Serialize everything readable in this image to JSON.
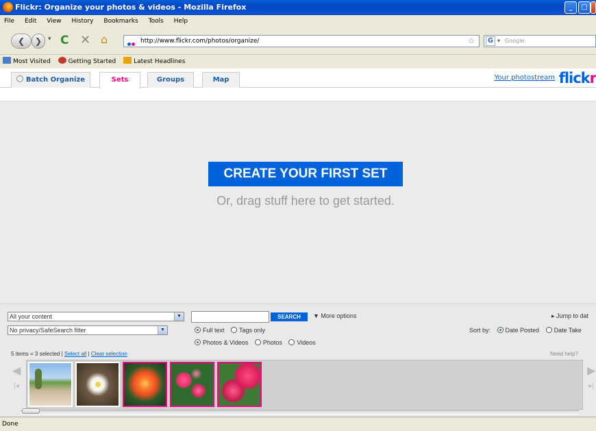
{
  "window": {
    "title": "Flickr: Organize your photos & videos - Mozilla Firefox"
  },
  "menu": [
    "File",
    "Edit",
    "View",
    "History",
    "Bookmarks",
    "Tools",
    "Help"
  ],
  "nav": {
    "url": "http://www.flickr.com/photos/organize/",
    "search_placeholder": "Google"
  },
  "bookmarks": [
    {
      "label": "Most Visited",
      "icon": "most-visited-icon",
      "color": "#4a7fc6"
    },
    {
      "label": "Getting Started",
      "icon": "firefox-icon",
      "color": "#c0392b"
    },
    {
      "label": "Latest Headlines",
      "icon": "rss-icon",
      "color": "#e8a400"
    }
  ],
  "tabs": [
    {
      "label": "Batch Organize",
      "active": false
    },
    {
      "label": "Sets",
      "active": true
    },
    {
      "label": "Groups",
      "active": false
    },
    {
      "label": "Map",
      "active": false
    }
  ],
  "header": {
    "photostream_link": "Your photostream",
    "logo_blue": "flick",
    "logo_pink": "r",
    "brand_blue": "#0063dc",
    "brand_pink": "#ff0084"
  },
  "stage": {
    "create_button": "CREATE YOUR FIRST SET",
    "hint": "Or, drag stuff here to get started."
  },
  "panel": {
    "content_filter": "All your content",
    "privacy_filter": "No privacy/SafeSearch filter",
    "search_value": "",
    "search_button": "SEARCH",
    "more_options": "More options",
    "jump_to": "Jump to dat",
    "text_options": [
      {
        "label": "Full text",
        "checked": true
      },
      {
        "label": "Tags only",
        "checked": false
      }
    ],
    "media_options": [
      {
        "label": "Photos & Videos",
        "checked": true
      },
      {
        "label": "Photos",
        "checked": false
      },
      {
        "label": "Videos",
        "checked": false
      }
    ],
    "sort_label": "Sort by:",
    "sort_options": [
      {
        "label": "Date Posted",
        "checked": true
      },
      {
        "label": "Date Take",
        "checked": false
      }
    ],
    "selection_info": "5 items = 3 selected |",
    "select_all": "Select all",
    "separator": "|",
    "clear_selection": "Clear selection",
    "need_help": "Need help?"
  },
  "thumbnails": [
    {
      "name": "beach-photo",
      "selected": false
    },
    {
      "name": "white-flower-photo",
      "selected": false
    },
    {
      "name": "orange-flower-photo",
      "selected": true
    },
    {
      "name": "pink-flowers-photo",
      "selected": true
    },
    {
      "name": "hibiscus-photo",
      "selected": true
    }
  ],
  "status": {
    "text": "Done"
  }
}
